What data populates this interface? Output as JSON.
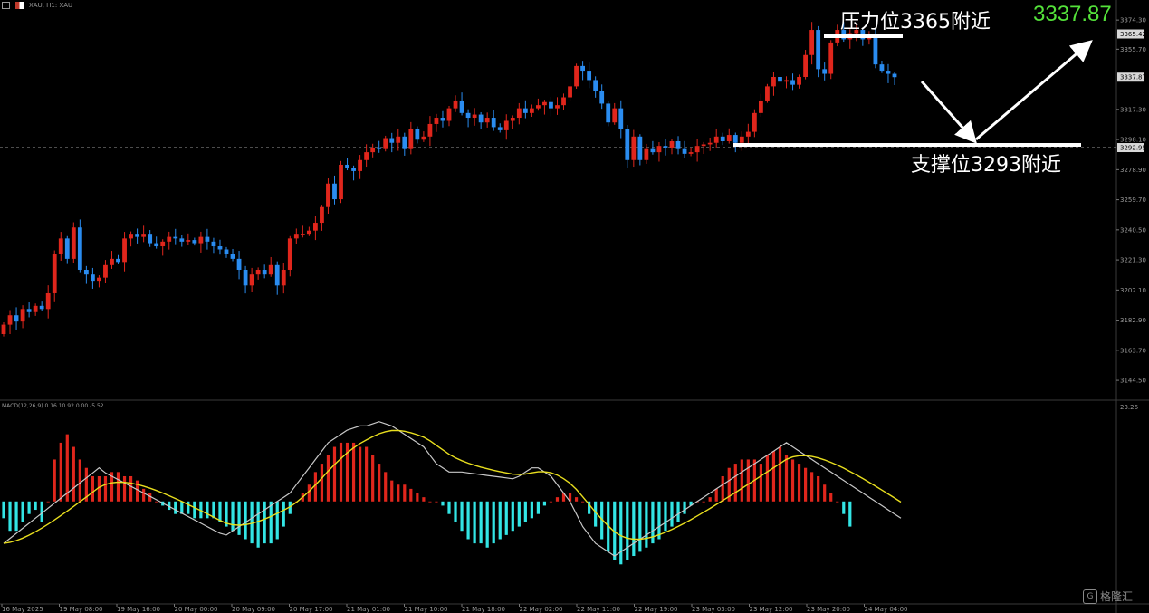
{
  "toolbar": {
    "symbol_text": "XAU, H1: XAU",
    "icons": [
      "chart-icon",
      "symbol-flag-icon"
    ]
  },
  "annotations": {
    "resistance": "压力位3365附近",
    "support": "支撑位3293附近",
    "target": "3337.87"
  },
  "price_axis": {
    "ticks": [
      "3374.30",
      "3355.70",
      "3317.30",
      "3298.10",
      "3278.90",
      "3259.70",
      "3240.50",
      "3221.30",
      "3202.10",
      "3182.90",
      "3163.70",
      "3144.50"
    ],
    "ylim": [
      3133,
      3379
    ],
    "tags": [
      {
        "value": 3365.42,
        "label": "3365.42"
      },
      {
        "value": 3337.87,
        "label": "3337.87"
      },
      {
        "value": 3292.95,
        "label": "3292.95"
      }
    ],
    "dashed_levels": [
      3365.42,
      3292.95
    ]
  },
  "macd": {
    "label": "MACD(12,26,9) 0.16 10.92 0.00 -5.52",
    "axis_label": "23.26",
    "colors": {
      "hist_up": "#e0261c",
      "hist_down": "#33e5e5",
      "macd_line": "#c8c8c8",
      "signal_line": "#e8de1e"
    }
  },
  "time_axis": {
    "labels": [
      "16 May 2025",
      "19 May 08:00",
      "19 May 16:00",
      "20 May 00:00",
      "20 May 09:00",
      "20 May 17:00",
      "21 May 01:00",
      "21 May 10:00",
      "21 May 18:00",
      "22 May 02:00",
      "22 May 11:00",
      "22 May 19:00",
      "23 May 03:00",
      "23 May 12:00",
      "23 May 20:00",
      "24 May 04:00"
    ]
  },
  "watermark": {
    "text": "格隆汇",
    "icon": "gelonghui-logo-icon"
  },
  "chart_data": [
    {
      "type": "candlestick",
      "title": "",
      "xlabel": "",
      "ylabel": "",
      "ylim": [
        3133,
        3379
      ],
      "colors": {
        "up": "#e0261c",
        "down": "#2a8cf0"
      },
      "close": [
        3180,
        3186,
        3182,
        3190,
        3188,
        3192,
        3190,
        3200,
        3225,
        3235,
        3222,
        3242,
        3215,
        3212,
        3208,
        3210,
        3218,
        3222,
        3220,
        3235,
        3238,
        3236,
        3238,
        3232,
        3230,
        3233,
        3236,
        3235,
        3233,
        3234,
        3232,
        3236,
        3233,
        3230,
        3228,
        3225,
        3222,
        3215,
        3205,
        3212,
        3215,
        3212,
        3218,
        3205,
        3215,
        3235,
        3238,
        3238,
        3240,
        3245,
        3255,
        3270,
        3260,
        3282,
        3280,
        3278,
        3285,
        3290,
        3293,
        3292,
        3299,
        3296,
        3300,
        3292,
        3305,
        3298,
        3300,
        3308,
        3312,
        3310,
        3318,
        3323,
        3315,
        3312,
        3314,
        3309,
        3312,
        3306,
        3304,
        3310,
        3312,
        3318,
        3315,
        3318,
        3320,
        3322,
        3318,
        3320,
        3325,
        3332,
        3345,
        3342,
        3336,
        3329,
        3321,
        3309,
        3318,
        3305,
        3285,
        3300,
        3285,
        3292,
        3290,
        3294,
        3293,
        3297,
        3292,
        3289,
        3290,
        3294,
        3295,
        3296,
        3300,
        3297,
        3301,
        3296,
        3300,
        3303,
        3315,
        3323,
        3332,
        3338,
        3335,
        3336,
        3333,
        3338,
        3352,
        3368,
        3343,
        3340,
        3360,
        3368,
        3362,
        3366,
        3368,
        3362,
        3364,
        3346,
        3342,
        3340,
        3337.87
      ],
      "up_moves": 71,
      "down_moves": 69,
      "support": 3293,
      "resistance": 3365,
      "target": 3337.87
    },
    {
      "type": "bar+line",
      "title": "MACD(12,26,9)",
      "xlabel": "",
      "ylabel": "",
      "ylim": [
        -24,
        23.26
      ],
      "histogram": [
        -4,
        -7,
        -7,
        -5,
        -3,
        -2,
        -5,
        0,
        10,
        14,
        16,
        13,
        10,
        8,
        6,
        6,
        6,
        7,
        7,
        6,
        6,
        5,
        3,
        2,
        0,
        -1,
        -2,
        -3,
        -3,
        -3,
        -4,
        -4,
        -4,
        -4,
        -5,
        -6,
        -7,
        -8,
        -9,
        -10,
        -11,
        -10,
        -10,
        -9,
        -6,
        -3,
        0,
        2,
        4,
        7,
        9,
        11,
        13,
        14,
        14,
        14,
        13,
        13,
        11,
        9,
        7,
        5,
        4,
        4,
        3,
        2,
        1,
        0,
        0,
        -1,
        -3,
        -5,
        -7,
        -9,
        -10,
        -10,
        -11,
        -10,
        -9,
        -8,
        -7,
        -6,
        -5,
        -4,
        -3,
        -1,
        0,
        1,
        2,
        2,
        1,
        0,
        -3,
        -6,
        -9,
        -12,
        -14,
        -15,
        -14,
        -13,
        -12,
        -11,
        -10,
        -9,
        -7,
        -6,
        -5,
        -3,
        -1,
        0,
        0,
        1,
        3,
        6,
        8,
        9,
        10,
        10,
        10,
        9,
        11,
        12,
        13,
        11,
        10,
        9,
        8,
        7,
        6,
        4,
        2,
        0,
        -3,
        -6
      ],
      "macd_line": [
        -10,
        -8.8,
        -7.6,
        -6.4,
        -5.2,
        -4.0,
        -2.8,
        -1.6,
        -0.4,
        0.8,
        2.0,
        3.2,
        4.4,
        5.6,
        6.8,
        8,
        6.8,
        6,
        5.2,
        4.4,
        3.6,
        2.8,
        2,
        1.2,
        0.4,
        -0.4,
        -1.2,
        -2,
        -2.8,
        -3.6,
        -4.4,
        -5.2,
        -6,
        -6.8,
        -7.6,
        -8,
        -7,
        -6,
        -5,
        -4,
        -3,
        -2,
        -1,
        0,
        1,
        2,
        4,
        6,
        8,
        10,
        12,
        14,
        15,
        16,
        17,
        17.5,
        18,
        18,
        18.5,
        19,
        18.5,
        18,
        17,
        16,
        15,
        14,
        13,
        11,
        9,
        8,
        7,
        7,
        7,
        6.8,
        6.6,
        6.4,
        6.2,
        6,
        5.8,
        5.6,
        5.4,
        6,
        7,
        8,
        8,
        7,
        6,
        4,
        2,
        0,
        -3,
        -6,
        -8,
        -10,
        -11,
        -12,
        -13,
        -12,
        -11,
        -10,
        -9,
        -8,
        -7,
        -6,
        -5,
        -4,
        -3,
        -2,
        -1,
        0,
        1,
        2,
        3,
        4,
        5,
        6,
        7,
        8,
        9,
        10,
        11,
        12,
        13,
        14,
        13,
        12,
        11,
        10,
        9,
        8,
        7,
        6,
        5,
        4,
        3,
        2,
        1,
        0,
        -1,
        -2,
        -3,
        -4
      ]
    }
  ]
}
